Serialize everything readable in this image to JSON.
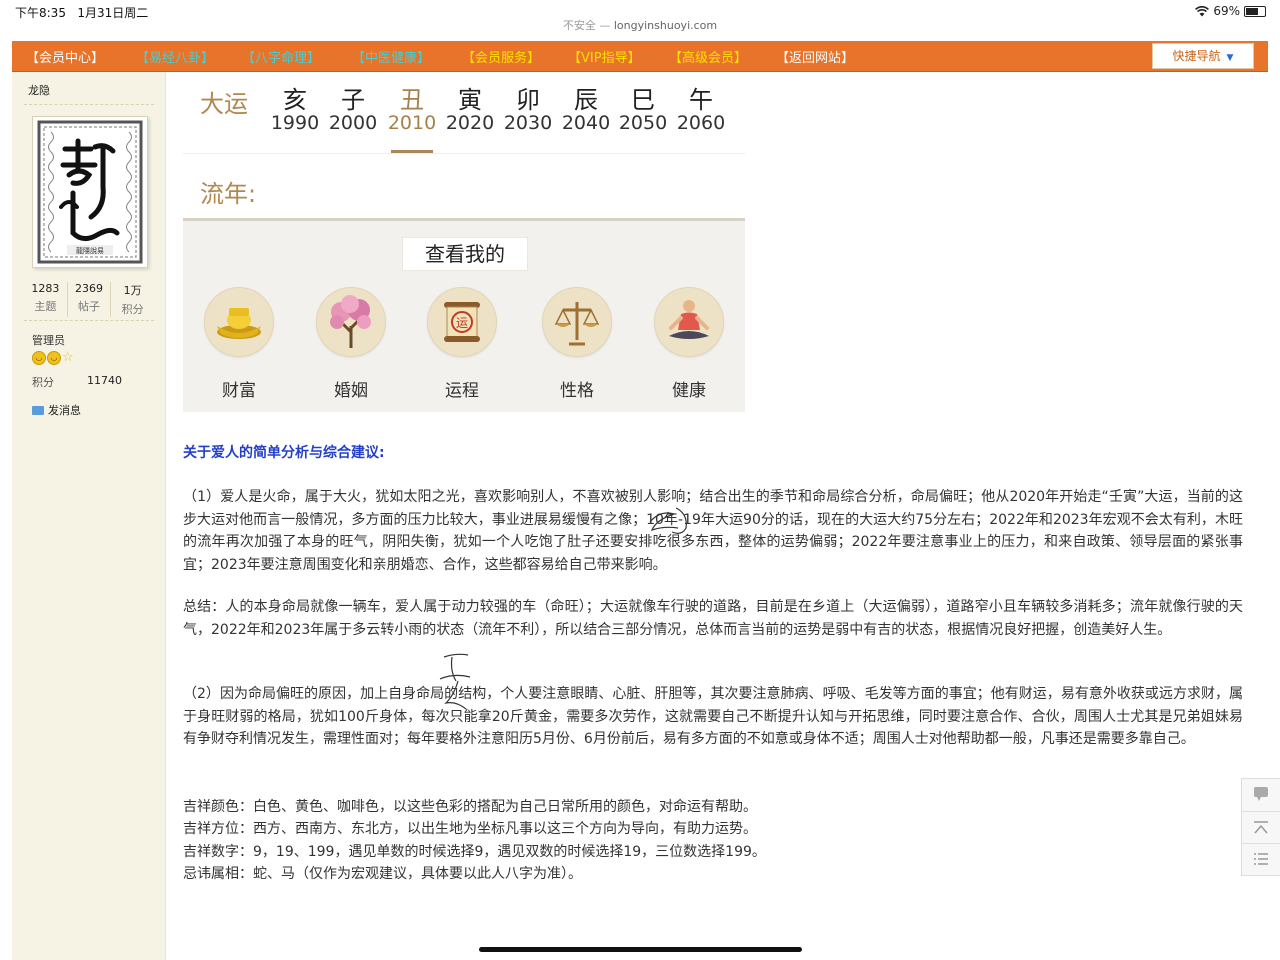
{
  "status_bar": {
    "time": "下午8:35",
    "date": "1月31日周二",
    "battery": "69%",
    "battery_level": 0.69
  },
  "address": {
    "insecure": "不安全",
    "separator": "—",
    "domain": "longyinshuoyi.com"
  },
  "nav": {
    "items": [
      {
        "label": "【会员中心】",
        "color": "#ffffff"
      },
      {
        "label": "【易经八卦】",
        "color": "#3fd2d8"
      },
      {
        "label": "【八字命理】",
        "color": "#3fd2d8"
      },
      {
        "label": "【中医健康】",
        "color": "#3fd2d8"
      },
      {
        "label": "【会员服务】",
        "color": "#ffe100"
      },
      {
        "label": "【VIP指导】",
        "color": "#ffe100"
      },
      {
        "label": "【高级会员】",
        "color": "#ffe100"
      },
      {
        "label": "【返回网站】",
        "color": "#ffffff"
      }
    ],
    "quick_nav": "快捷导航"
  },
  "sidebar": {
    "username": "龙隐",
    "avatar_caption": "龍隱說易",
    "stats": [
      {
        "value": "1283",
        "label": "主题"
      },
      {
        "value": "2369",
        "label": "帖子"
      },
      {
        "value": "1万",
        "label": "积分"
      }
    ],
    "role": "管理员",
    "score_label": "积分",
    "score_value": "11740",
    "message": "发消息"
  },
  "dayun": {
    "label": "大运",
    "columns": [
      {
        "gan": "亥",
        "year": "1990"
      },
      {
        "gan": "子",
        "year": "2000"
      },
      {
        "gan": "丑",
        "year": "2010"
      },
      {
        "gan": "寅",
        "year": "2020"
      },
      {
        "gan": "卯",
        "year": "2030"
      },
      {
        "gan": "辰",
        "year": "2040"
      },
      {
        "gan": "巳",
        "year": "2050"
      },
      {
        "gan": "午",
        "year": "2060"
      }
    ],
    "selected_index": 2
  },
  "liunian": {
    "label": "流年:"
  },
  "panel": {
    "title": "查看我的",
    "buttons": [
      {
        "label": "财富",
        "icon": "gold-ingot-icon"
      },
      {
        "label": "婚姻",
        "icon": "peach-blossom-tree-icon"
      },
      {
        "label": "运程",
        "icon": "fortune-scroll-icon"
      },
      {
        "label": "性格",
        "icon": "balance-scale-icon"
      },
      {
        "label": "健康",
        "icon": "meditation-figure-icon"
      }
    ],
    "scroll_seal_text": "运"
  },
  "content": {
    "heading": "关于爱人的简单分析与综合建议:",
    "paragraphs": [
      "（1）爱人是火命，属于大火，犹如太阳之光，喜欢影响别人，不喜欢被别人影响；结合出生的季节和命局综合分析，命局偏旺；他从2020年开始走“壬寅”大运，当前的这步大运对他而言一般情况，多方面的压力比较大，事业进展易缓慢有之像；10年-19年大运90分的话，现在的大运大约75分左右；2022年和2023年宏观不会太有利，木旺的流年再次加强了本身的旺气，阴阳失衡，犹如一个人吃饱了肚子还要安排吃很多东西，整体的运势偏弱；2022年要注意事业上的压力，和来自政策、领导层面的紧张事宜；2023年要注意周围变化和亲朋婚恋、合作，这些都容易给自己带来影响。",
      "总结：人的本身命局就像一辆车，爱人属于动力较强的车（命旺）；大运就像车行驶的道路，目前是在乡道上（大运偏弱），道路窄小且车辆较多消耗多；流年就像行驶的天气，2022年和2023年属于多云转小雨的状态（流年不利），所以结合三部分情况，总体而言当前的运势是弱中有吉的状态，根据情况良好把握，创造美好人生。",
      "（2）因为命局偏旺的原因，加上自身命局的结构，个人要注意眼睛、心脏、肝胆等，其次要注意肺病、呼吸、毛发等方面的事宜；他有财运，易有意外收获或远方求财，属于身旺财弱的格局，犹如100斤身体，每次只能拿20斤黄金，需要多次劳作，这就需要自己不断提升认知与开拓思维，同时要注意合作、合伙，周围人士尤其是兄弟姐妹易有争财夺利情况发生，需理性面对；每年要格外注意阳历5月份、6月份前后，易有多方面的不如意或身体不适；周围人士对他帮助都一般，凡事还是需要多靠自己。"
    ],
    "lucky": [
      "吉祥颜色：白色、黄色、咖啡色，以这些色彩的搭配为自己日常所用的颜色，对命运有帮助。",
      "吉祥方位：西方、西南方、东北方，以出生地为坐标凡事以这三个方向为导向，有助力运势。",
      "吉祥数字：9，19、199，遇见单数的时候选择9，遇见双数的时候选择19，三位数选择199。",
      "忌讳属相：蛇、马（仅作为宏观建议，具体要以此人八字为准）。"
    ]
  },
  "colors": {
    "nav_bg": "#e8732a",
    "accent": "#b08850",
    "heading": "#2440c8"
  }
}
